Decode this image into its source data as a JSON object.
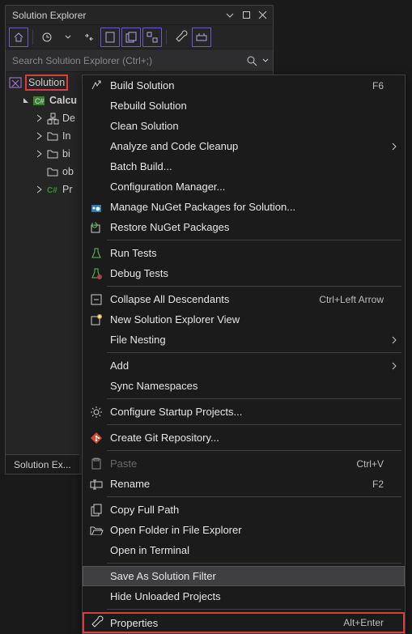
{
  "panel": {
    "title": "Solution Explorer",
    "tab_label": "Solution Ex..."
  },
  "search": {
    "placeholder": "Search Solution Explorer (Ctrl+;)"
  },
  "tree": {
    "solution_label": "Solution",
    "project_label": "Calcu",
    "items": [
      {
        "label": "De"
      },
      {
        "label": "In"
      },
      {
        "label": "bi"
      },
      {
        "label": "ob"
      },
      {
        "label": "Pr"
      }
    ]
  },
  "menu": {
    "groups": [
      [
        {
          "id": "build",
          "label": "Build Solution",
          "shortcut": "F6",
          "icon": "build"
        },
        {
          "id": "rebuild",
          "label": "Rebuild Solution"
        },
        {
          "id": "clean",
          "label": "Clean Solution"
        },
        {
          "id": "analyze",
          "label": "Analyze and Code Cleanup",
          "submenu": true
        },
        {
          "id": "batch",
          "label": "Batch Build..."
        },
        {
          "id": "config",
          "label": "Configuration Manager..."
        },
        {
          "id": "nuget-manage",
          "label": "Manage NuGet Packages for Solution...",
          "icon": "nuget"
        },
        {
          "id": "nuget-restore",
          "label": "Restore NuGet Packages",
          "icon": "restore"
        }
      ],
      [
        {
          "id": "run-tests",
          "label": "Run Tests",
          "icon": "flask-run"
        },
        {
          "id": "debug-tests",
          "label": "Debug Tests",
          "icon": "flask-debug"
        }
      ],
      [
        {
          "id": "collapse",
          "label": "Collapse All Descendants",
          "shortcut": "Ctrl+Left Arrow",
          "icon": "collapse"
        },
        {
          "id": "new-view",
          "label": "New Solution Explorer View",
          "icon": "new-view"
        },
        {
          "id": "file-nesting",
          "label": "File Nesting",
          "submenu": true
        }
      ],
      [
        {
          "id": "add",
          "label": "Add",
          "submenu": true
        },
        {
          "id": "sync-ns",
          "label": "Sync Namespaces"
        }
      ],
      [
        {
          "id": "startup",
          "label": "Configure Startup Projects...",
          "icon": "gear"
        }
      ],
      [
        {
          "id": "git",
          "label": "Create Git Repository...",
          "icon": "git"
        }
      ],
      [
        {
          "id": "paste",
          "label": "Paste",
          "shortcut": "Ctrl+V",
          "icon": "paste",
          "disabled": true
        },
        {
          "id": "rename",
          "label": "Rename",
          "shortcut": "F2",
          "icon": "rename"
        }
      ],
      [
        {
          "id": "copy-path",
          "label": "Copy Full Path",
          "icon": "copy"
        },
        {
          "id": "open-folder",
          "label": "Open Folder in File Explorer",
          "icon": "folder-open"
        },
        {
          "id": "terminal",
          "label": "Open in Terminal"
        }
      ],
      [
        {
          "id": "save-filter",
          "label": "Save As Solution Filter",
          "hovered": true
        },
        {
          "id": "hide-unloaded",
          "label": "Hide Unloaded Projects"
        }
      ],
      [
        {
          "id": "properties",
          "label": "Properties",
          "shortcut": "Alt+Enter",
          "icon": "wrench",
          "red": true
        }
      ]
    ]
  }
}
